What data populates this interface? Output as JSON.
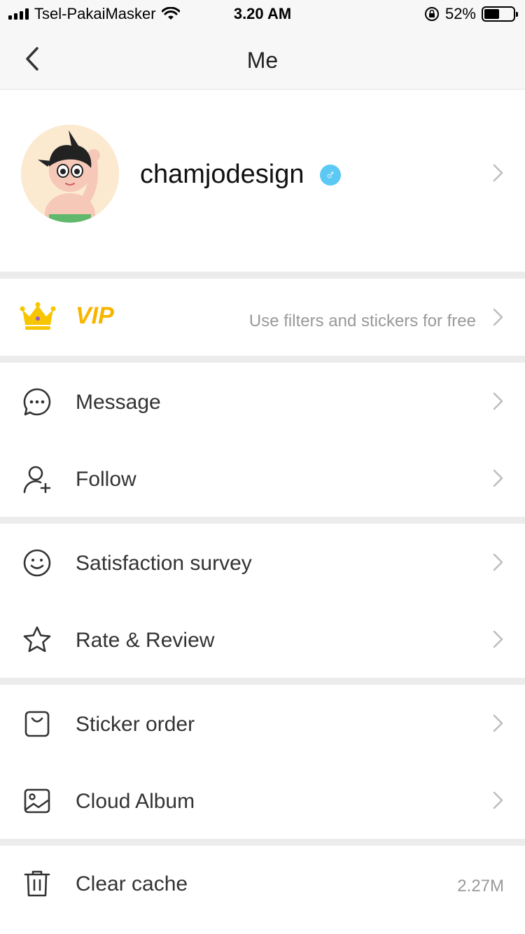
{
  "status_bar": {
    "carrier": "Tsel-PakaiMasker",
    "time": "3.20 AM",
    "battery_percent": "52%",
    "battery_level": 0.52
  },
  "nav": {
    "title": "Me",
    "back_icon": "chevron-left-icon"
  },
  "profile": {
    "username": "chamjodesign",
    "gender_symbol": "♂",
    "gender_color": "#5cc9f5"
  },
  "vip": {
    "label": "VIP",
    "description": "Use filters and stickers for free",
    "accent_color": "#f7b500"
  },
  "menu": {
    "message": "Message",
    "follow": "Follow",
    "survey": "Satisfaction survey",
    "rate": "Rate & Review",
    "sticker_order": "Sticker order",
    "cloud_album": "Cloud Album",
    "clear_cache": "Clear cache",
    "cache_size": "2.27M"
  }
}
